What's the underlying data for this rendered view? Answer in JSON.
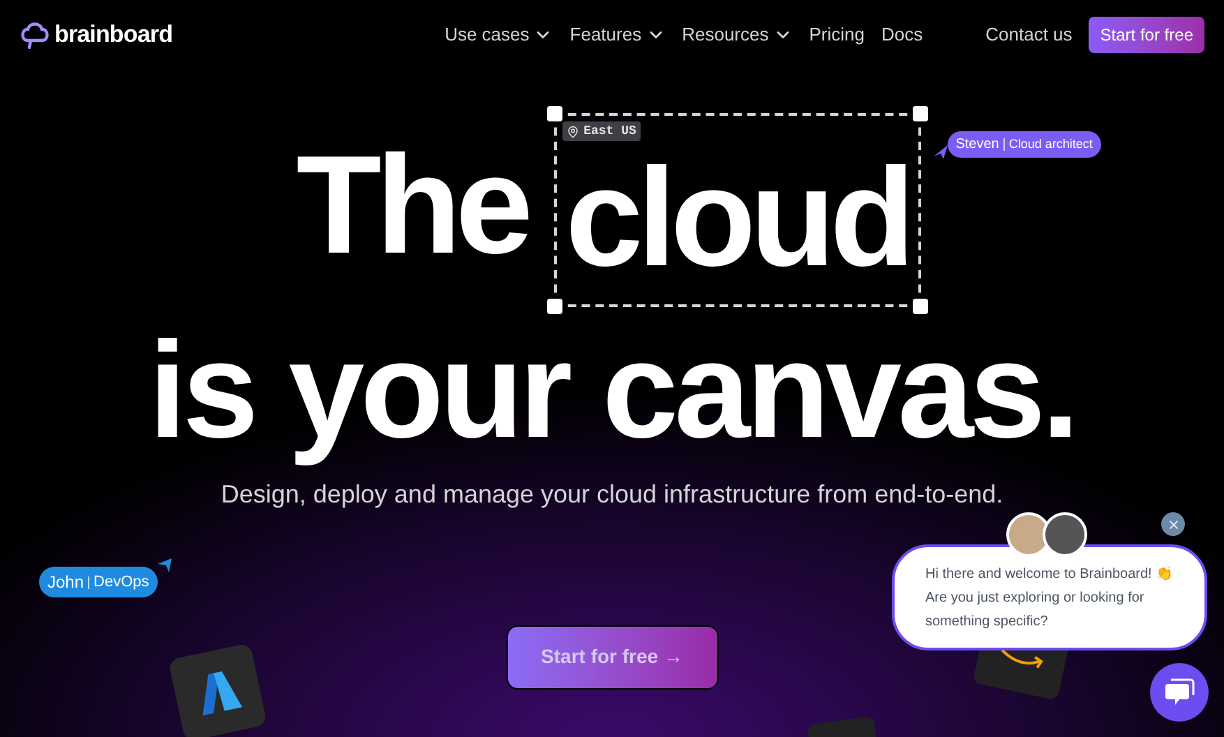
{
  "nav": {
    "logo": "brainboard",
    "links": [
      {
        "label": "Use cases",
        "dropdown": true
      },
      {
        "label": "Features",
        "dropdown": true
      },
      {
        "label": "Resources",
        "dropdown": true
      },
      {
        "label": "Pricing",
        "dropdown": false
      },
      {
        "label": "Docs",
        "dropdown": false
      }
    ],
    "contact": "Contact us",
    "cta": "Start for free"
  },
  "hero": {
    "line1_start": "The",
    "line1_selected": "cloud",
    "line2": "is your canvas.",
    "region_tag": "East US",
    "subtitle": "Design, deploy and manage your cloud infrastructure from end-to-end.",
    "cta": "Start for free →"
  },
  "cursors": [
    {
      "name": "Steven",
      "role": "Cloud architect",
      "color": "#7c5cf5"
    },
    {
      "name": "John",
      "role": "DevOps",
      "color": "#1f8be0"
    }
  ],
  "chat": {
    "lines": [
      "Hi there and welcome to Brainboard! 👏",
      "Are you just exploring or looking for",
      "something specific?"
    ]
  }
}
